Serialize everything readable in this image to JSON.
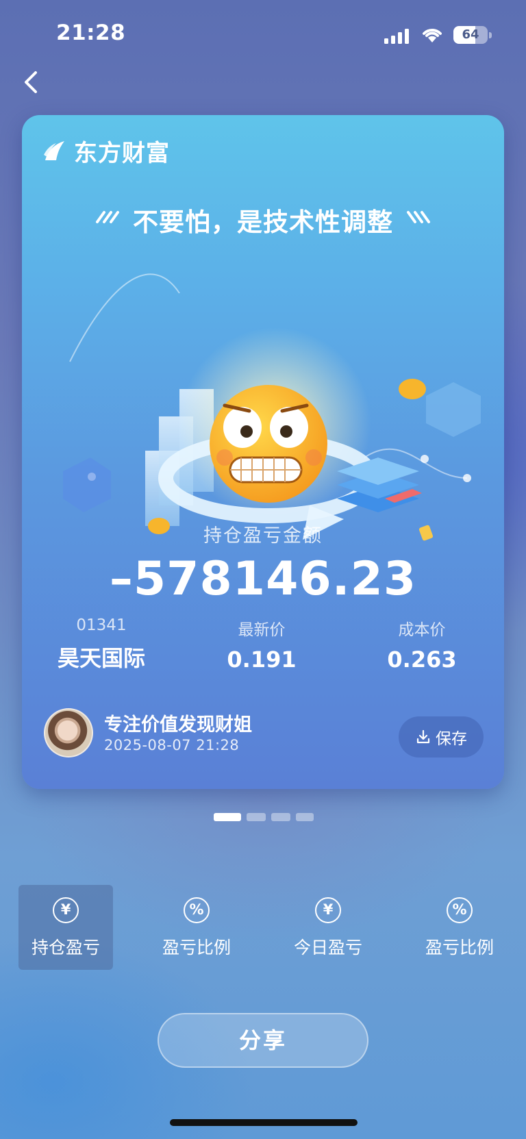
{
  "status_bar": {
    "time": "21:28",
    "battery_level": "64",
    "battery_fraction": 0.64
  },
  "nav": {
    "back_icon": "chevron-left-icon"
  },
  "card": {
    "brand_name": "东方财富",
    "headline": "不要怕，是技术性调整",
    "amount_label": "持仓盈亏金额",
    "amount_value": "–578146.23",
    "stock_code": "01341",
    "stock_name": "昊天国际",
    "latest_price_label": "最新价",
    "latest_price": "0.191",
    "cost_price_label": "成本价",
    "cost_price": "0.263",
    "author_name": "专注价值发现财姐",
    "author_time": "2025-08-07 21:28",
    "save_label": "保存"
  },
  "pager": {
    "count": 4,
    "active_index": 0
  },
  "tabs": [
    {
      "label": "持仓盈亏",
      "icon": "yen-icon",
      "glyph": "¥",
      "active": true
    },
    {
      "label": "盈亏比例",
      "icon": "percent-icon",
      "glyph": "%",
      "active": false
    },
    {
      "label": "今日盈亏",
      "icon": "yen-icon",
      "glyph": "¥",
      "active": false
    },
    {
      "label": "盈亏比例",
      "icon": "percent-icon",
      "glyph": "%",
      "active": false
    }
  ],
  "share_label": "分享",
  "colors": {
    "card_top": "#5fc4ea",
    "card_bottom": "#5a80d6",
    "emoji_yellow": "#f7b52c"
  }
}
